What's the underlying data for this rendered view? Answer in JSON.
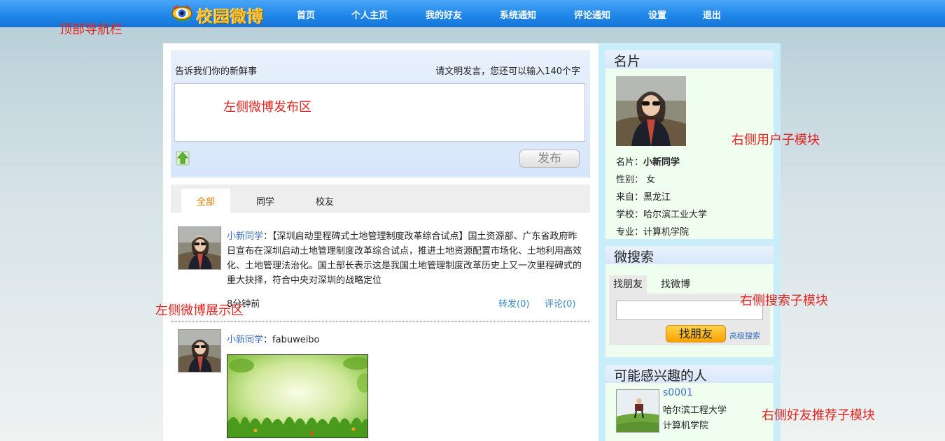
{
  "nav": {
    "logo_text": "校园微博",
    "links": [
      "首页",
      "个人主页",
      "我的好友",
      "系统通知",
      "评论通知",
      "设置",
      "退出"
    ]
  },
  "annotations": {
    "top_nav": "顶部导航栏",
    "publish_area": "左侧微博发布区",
    "feed_area": "左侧微博展示区",
    "user_module": "右侧用户子模块",
    "search_module": "右侧搜索子模块",
    "recommend_module": "右侧好友推荐子模块"
  },
  "publish": {
    "prompt": "告诉我们你的新鲜事",
    "hint": "请文明发言，您还可以输入140个字",
    "button": "发布"
  },
  "feed_tabs": [
    "全部",
    "同学",
    "校友"
  ],
  "posts": [
    {
      "user": "小新同学",
      "sep": "：",
      "content": "【深圳启动里程碑式土地管理制度改革综合试点】国土资源部、广东省政府昨日宣布在深圳启动土地管理制度改革综合试点，推进土地资源配置市场化、土地利用高效化、土地管理法治化。国土部长表示这是我国土地管理制度改革历史上又一次里程碑式的重大抉择，符合中央对深圳的战略定位",
      "time": "8分钟前",
      "repost": "转发(0)",
      "comment": "评论(0)"
    },
    {
      "user": "小新同学",
      "sep": "：",
      "content": "fabuweibo"
    }
  ],
  "profile": {
    "title": "名片",
    "fields": [
      {
        "label": "名片：",
        "value": "小新同学"
      },
      {
        "label": "性别：",
        "value": "女"
      },
      {
        "label": "来自：",
        "value": "黑龙江"
      },
      {
        "label": "学校：",
        "value": "哈尔滨工业大学"
      },
      {
        "label": "专业：",
        "value": "计算机学院"
      }
    ]
  },
  "search": {
    "title": "微搜索",
    "tabs": [
      "找朋友",
      "找微博"
    ],
    "button": "找朋友",
    "advanced": "高级搜索",
    "input_value": ""
  },
  "recommend": {
    "title": "可能感兴趣的人",
    "user": "s0001",
    "school": "哈尔滨工程大学",
    "college": "计算机学院"
  },
  "colors": {
    "nav_blue": "#1f86ea",
    "link_blue": "#3a6fc4",
    "annotation_red": "#e4241f",
    "tab_active": "#e07b00",
    "sidebar_bg": "#c9eef9",
    "card_bg": "#f0fef0"
  }
}
